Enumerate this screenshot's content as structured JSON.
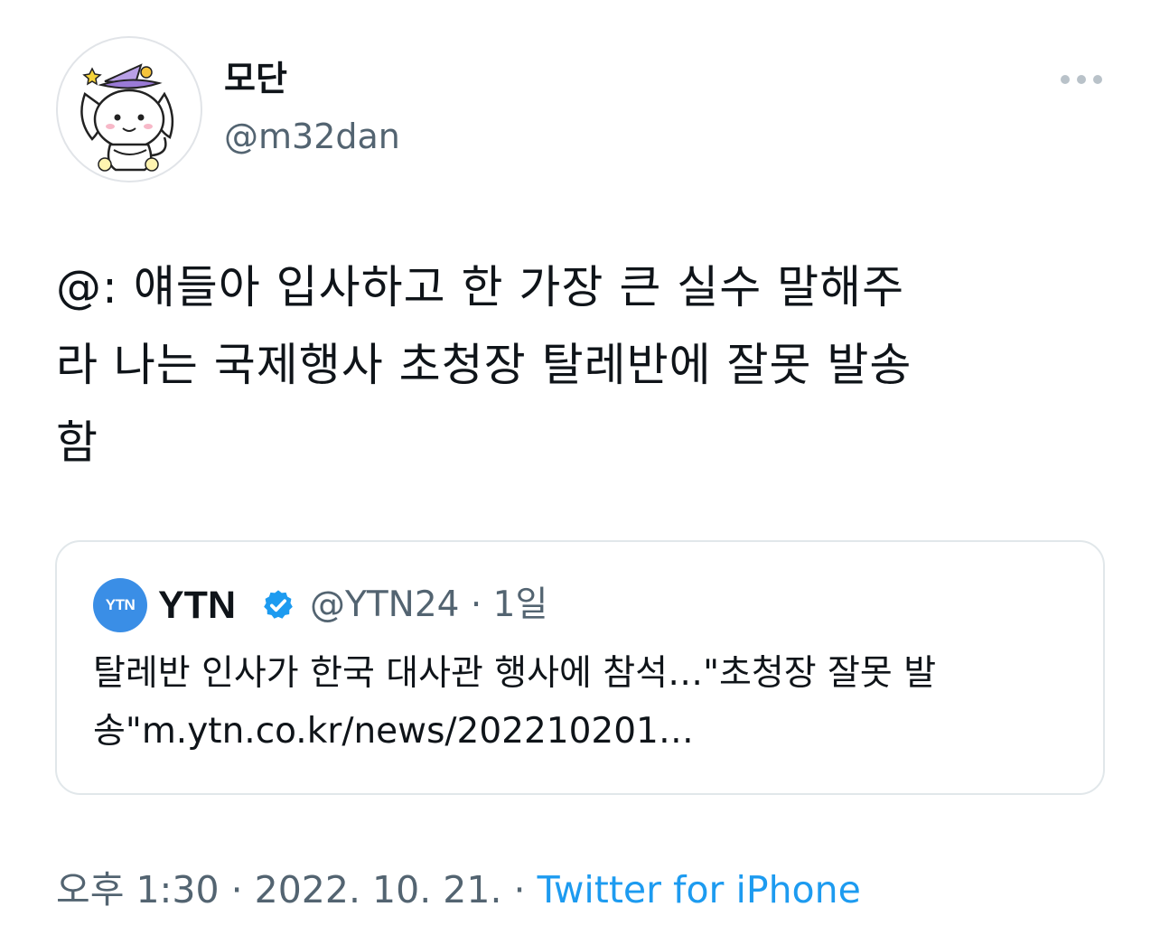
{
  "author": {
    "display_name": "모단",
    "handle": "@m32dan"
  },
  "more_icon": "ellipsis-icon",
  "tweet": {
    "text_lines": [
      "@: 얘들아 입사하고 한 가장 큰 실수 말해주",
      "라 나는 국제행사 초청장 탈레반에 잘못 발송",
      "함"
    ]
  },
  "quote": {
    "avatar_text": "YTN",
    "name": "YTN",
    "verified_icon": "verified-badge-icon",
    "verified_color": "#1d9bf0",
    "meta": "@YTN24 · 1일",
    "text_lines": [
      "탈레반 인사가 한국 대사관 행사에 참석…\"초청장 잘못 발",
      "송\"m.ytn.co.kr/news/202210201…"
    ]
  },
  "footer": {
    "time_date": "오후 1:30 · 2022. 10. 21. · ",
    "source": "Twitter for iPhone",
    "source_color": "#1d9bf0"
  }
}
